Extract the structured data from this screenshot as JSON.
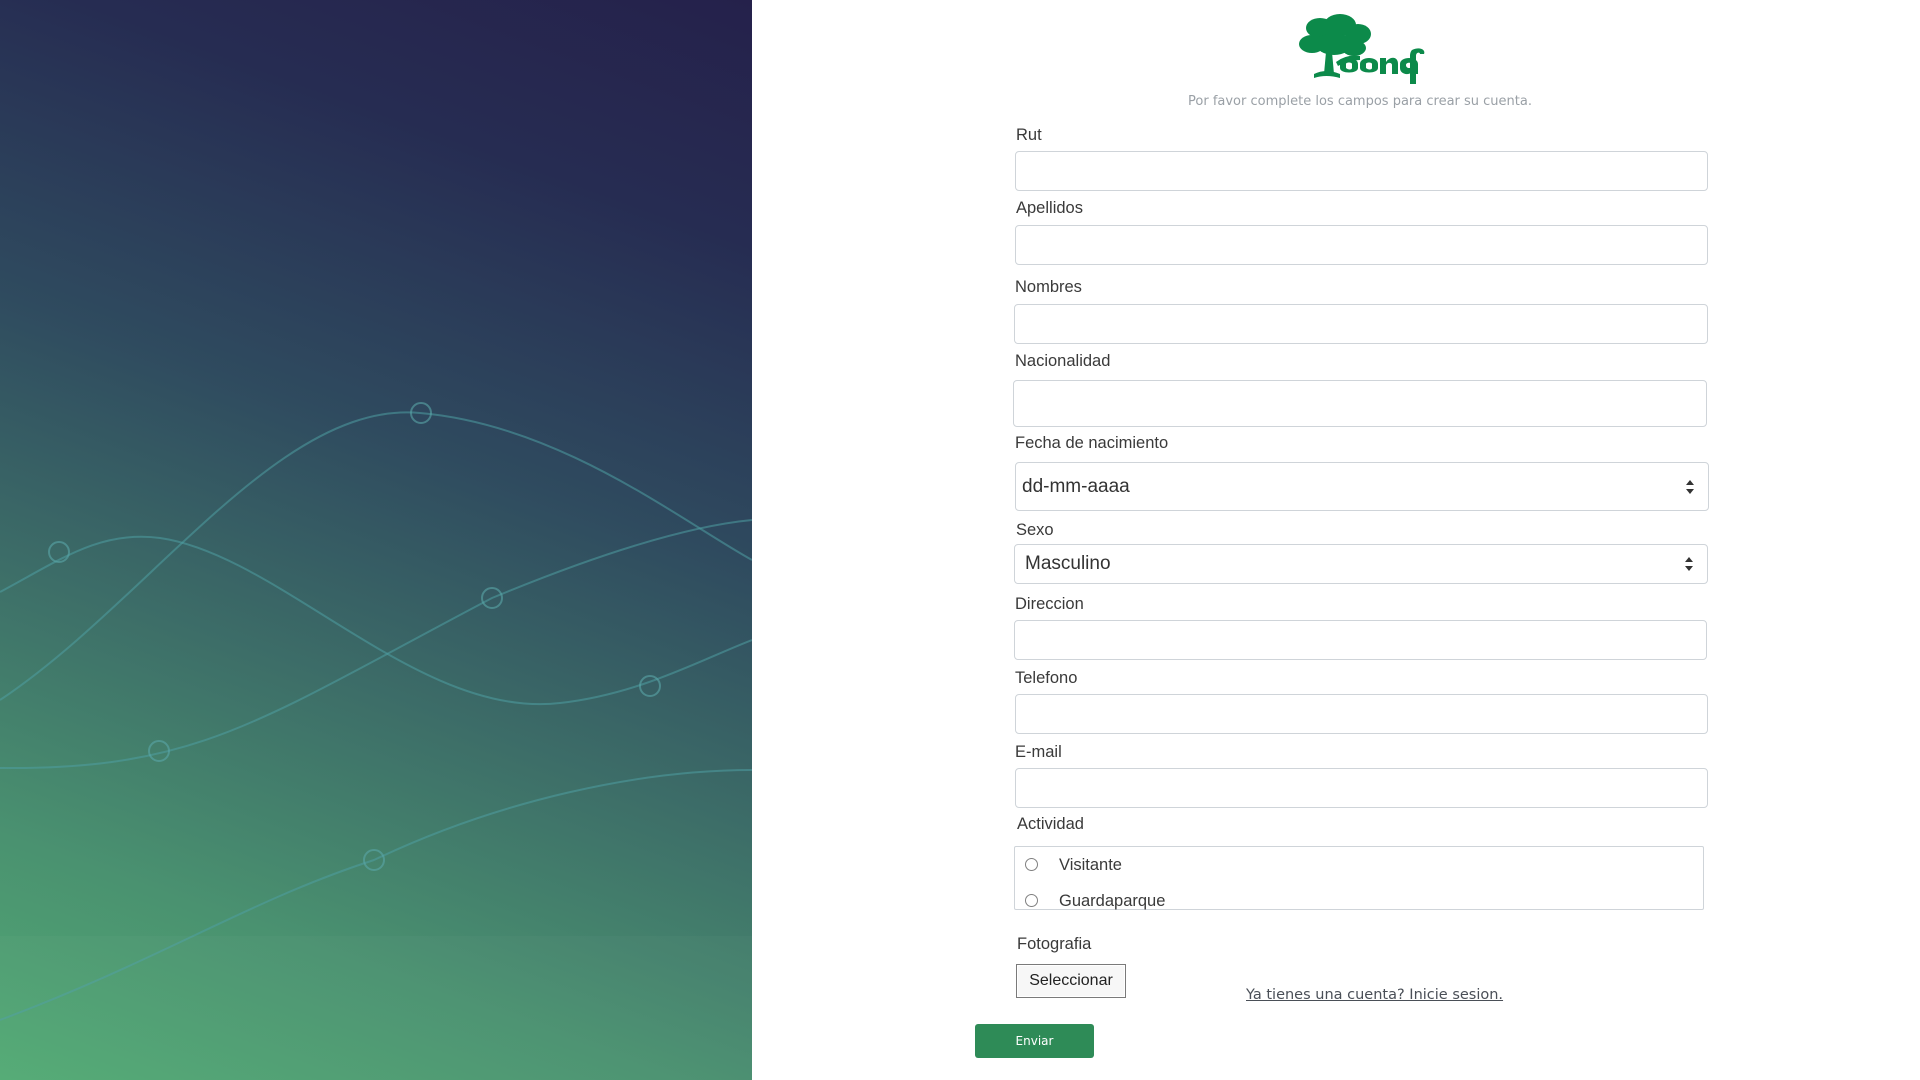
{
  "logo": {
    "alt_text": "conaf",
    "brand_color": "#0c8a4a"
  },
  "subtitle": "Por favor complete los campos para crear su cuenta.",
  "form": {
    "rut_label": "Rut",
    "apellidos_label": "Apellidos",
    "nombres_label": "Nombres",
    "nacionalidad_label": "Nacionalidad",
    "fecha_label": "Fecha de nacimiento",
    "fecha_value": "dd-mm-aaaa",
    "sexo_label": "Sexo",
    "sexo_value": "Masculino",
    "direccion_label": "Direccion",
    "telefono_label": "Telefono",
    "email_label": "E-mail",
    "actividad_label": "Actividad",
    "actividad_options": [
      "Visitante",
      "Guardaparque"
    ],
    "fotografia_label": "Fotografia",
    "file_button_label": "Seleccionar",
    "login_link": "Ya tienes una cuenta? Inicie sesion.",
    "submit_label": "Enviar"
  },
  "colors": {
    "accent": "#2e8b57",
    "panel_top": "#25214b",
    "panel_bottom": "#52aa74"
  }
}
